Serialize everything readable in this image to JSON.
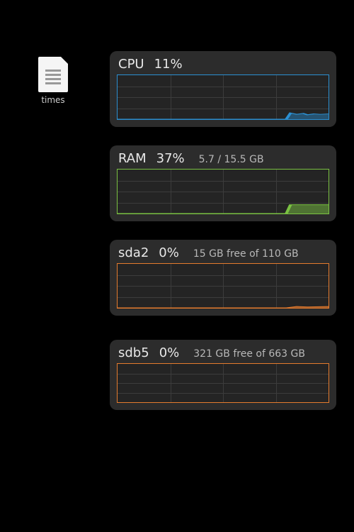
{
  "desktop": {
    "file_label": "times"
  },
  "monitors": {
    "cpu": {
      "label": "CPU",
      "value": "11%",
      "color": "#2b8fd1"
    },
    "ram": {
      "label": "RAM",
      "value": "37%",
      "detail": "5.7 / 15.5 GB",
      "color": "#7ac142"
    },
    "sda2": {
      "label": "sda2",
      "value": "0%",
      "detail": "15 GB free of 110 GB",
      "color": "#e47b2e"
    },
    "sdb5": {
      "label": "sdb5",
      "value": "0%",
      "detail": "321 GB free of 663 GB",
      "color": "#e47b2e"
    }
  },
  "chart_data": [
    {
      "type": "area",
      "name": "CPU",
      "title": "CPU 11%",
      "ylim": [
        0,
        100
      ],
      "x": [
        0,
        0.8,
        0.82,
        0.85,
        0.88,
        0.9,
        0.93,
        0.96,
        1.0
      ],
      "values": [
        0,
        0,
        14,
        11,
        13,
        10,
        12,
        11,
        12
      ],
      "color": "#2b8fd1"
    },
    {
      "type": "area",
      "name": "RAM",
      "title": "RAM 37% — 5.7 / 15.5 GB",
      "ylim": [
        0,
        100
      ],
      "x": [
        0,
        0.8,
        0.82,
        1.0
      ],
      "values": [
        0,
        0,
        20,
        20
      ],
      "color": "#7ac142"
    },
    {
      "type": "area",
      "name": "sda2",
      "title": "sda2 0% — 15 GB free of 110 GB",
      "ylim": [
        0,
        100
      ],
      "x": [
        0,
        0.8,
        0.85,
        0.9,
        1.0
      ],
      "values": [
        0,
        0,
        3,
        2,
        3
      ],
      "color": "#e47b2e"
    },
    {
      "type": "area",
      "name": "sdb5",
      "title": "sdb5 0% — 321 GB free of 663 GB",
      "ylim": [
        0,
        100
      ],
      "x": [
        0,
        1.0
      ],
      "values": [
        0,
        0
      ],
      "color": "#e47b2e"
    }
  ]
}
